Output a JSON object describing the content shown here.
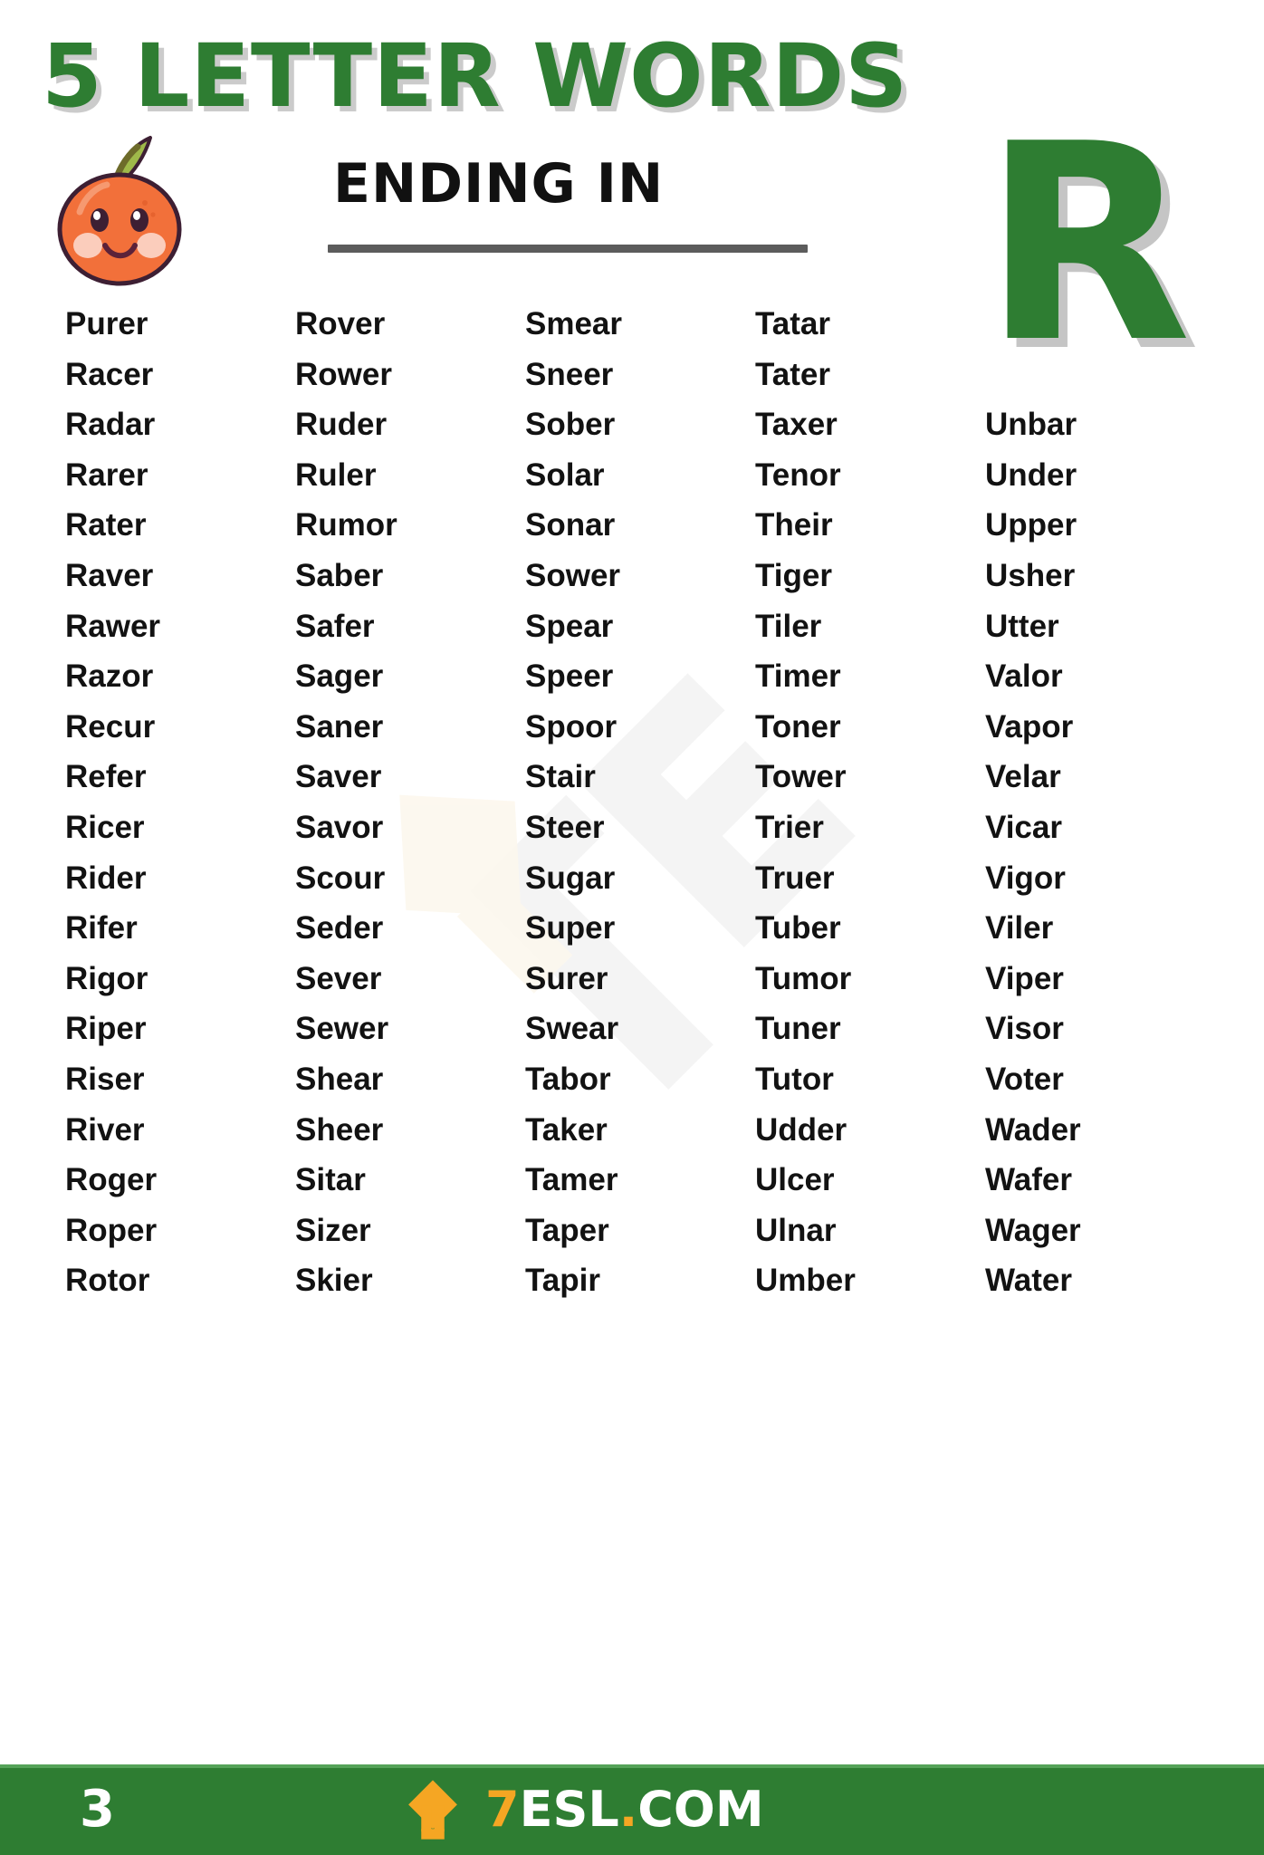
{
  "header": {
    "title": "5 LETTER WORDS",
    "subtitle": "ENDING IN",
    "letter": "R"
  },
  "colors": {
    "brand_green": "#2e7d32",
    "accent_orange": "#f5a623",
    "text_dark": "#121212",
    "fruit_orange": "#f2703a",
    "rule_gray": "#5c5c5c"
  },
  "icons": {
    "mascot": "orange-fruit-face-icon",
    "watermark": "7esl-watermark-icon",
    "brand_mark": "7esl-diamond-logo-icon"
  },
  "words": {
    "columns": [
      [
        "Purer",
        "Racer",
        "Radar",
        "Rarer",
        "Rater",
        "Raver",
        "Rawer",
        "Razor",
        "Recur",
        "Refer",
        "Ricer",
        "Rider",
        "Rifer",
        "Rigor",
        "Riper",
        "Riser",
        "River",
        "Roger",
        "Roper",
        "Rotor"
      ],
      [
        "Rover",
        "Rower",
        "Ruder",
        "Ruler",
        "Rumor",
        "Saber",
        "Safer",
        "Sager",
        "Saner",
        "Saver",
        "Savor",
        "Scour",
        "Seder",
        "Sever",
        "Sewer",
        "Shear",
        "Sheer",
        "Sitar",
        "Sizer",
        "Skier"
      ],
      [
        "Smear",
        "Sneer",
        "Sober",
        "Solar",
        "Sonar",
        "Sower",
        "Spear",
        "Speer",
        "Spoor",
        "Stair",
        "Steer",
        "Sugar",
        "Super",
        "Surer",
        "Swear",
        "Tabor",
        "Taker",
        "Tamer",
        "Taper",
        "Tapir"
      ],
      [
        "Tatar",
        "Tater",
        "Taxer",
        "Tenor",
        "Their",
        "Tiger",
        "Tiler",
        "Timer",
        "Toner",
        "Tower",
        "Trier",
        "Truer",
        "Tuber",
        "Tumor",
        "Tuner",
        "Tutor",
        "Udder",
        "Ulcer",
        "Ulnar",
        "Umber"
      ],
      [
        "",
        "",
        "Unbar",
        "Under",
        "Upper",
        "Usher",
        "Utter",
        "Valor",
        "Vapor",
        "Velar",
        "Vicar",
        "Vigor",
        "Viler",
        "Viper",
        "Visor",
        "Voter",
        "Wader",
        "Wafer",
        "Wager",
        "Water"
      ]
    ]
  },
  "footer": {
    "page_number": "3",
    "brand_seven": "7",
    "brand_name": "ESL",
    "brand_dot": ".",
    "brand_tld": "COM"
  }
}
